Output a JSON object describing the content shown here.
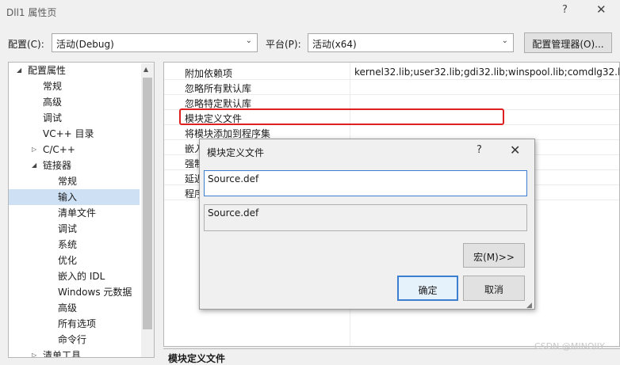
{
  "window": {
    "title": "Dll1 属性页",
    "help": "?",
    "close": "✕"
  },
  "config_bar": {
    "config_label": "配置(C):",
    "config_value": "活动(Debug)",
    "platform_label": "平台(P):",
    "platform_value": "活动(x64)",
    "manager_button": "配置管理器(O)..."
  },
  "tree": {
    "items": [
      {
        "label": "配置属性",
        "expander": "◢"
      },
      {
        "label": "常规"
      },
      {
        "label": "高级"
      },
      {
        "label": "调试"
      },
      {
        "label": "VC++ 目录"
      },
      {
        "label": "C/C++",
        "expander": "▷"
      },
      {
        "label": "链接器",
        "expander": "◢"
      },
      {
        "label": "常规"
      },
      {
        "label": "输入"
      },
      {
        "label": "清单文件"
      },
      {
        "label": "调试"
      },
      {
        "label": "系统"
      },
      {
        "label": "优化"
      },
      {
        "label": "嵌入的 IDL"
      },
      {
        "label": "Windows 元数据"
      },
      {
        "label": "高级"
      },
      {
        "label": "所有选项"
      },
      {
        "label": "命令行"
      },
      {
        "label": "清单工具",
        "expander": "▷"
      }
    ],
    "selected": "输入"
  },
  "grid": {
    "rows": [
      {
        "name": "附加依赖项",
        "value": "kernel32.lib;user32.lib;gdi32.lib;winspool.lib;comdlg32.lib"
      },
      {
        "name": "忽略所有默认库",
        "value": ""
      },
      {
        "name": "忽略特定默认库",
        "value": ""
      },
      {
        "name": "模块定义文件",
        "value": ""
      },
      {
        "name": "将模块添加到程序集",
        "value": ""
      },
      {
        "name": "嵌入",
        "value": ""
      },
      {
        "name": "强制",
        "value": ""
      },
      {
        "name": "延迟",
        "value": ""
      },
      {
        "name": "程序",
        "value": ""
      }
    ],
    "description_title": "模块定义文件"
  },
  "dialog": {
    "title": "模块定义文件",
    "help": "?",
    "close": "✕",
    "input_value": "Source.def",
    "evaluated_value": "Source.def",
    "macro_button": "宏(M)>>",
    "ok_button": "确定",
    "cancel_button": "取消"
  },
  "watermark": "CSDN @MINOIIY"
}
